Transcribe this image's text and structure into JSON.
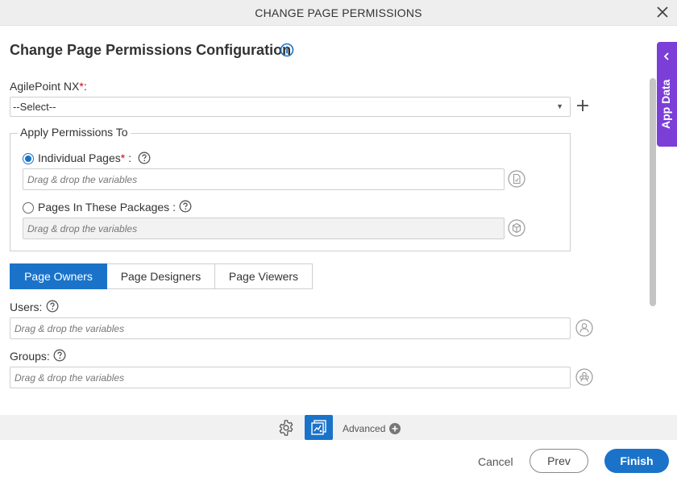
{
  "window": {
    "title": "CHANGE PAGE PERMISSIONS"
  },
  "heading": "Change Page Permissions Configuration",
  "agilepoint": {
    "label": "AgilePoint NX",
    "required_mark": "*",
    "suffix": ":",
    "selected": "--Select--"
  },
  "apply_permissions": {
    "legend": "Apply Permissions To",
    "individual": {
      "label": "Individual Pages",
      "required_mark": "*",
      "suffix": " :",
      "placeholder": "Drag & drop the variables",
      "selected": true
    },
    "packages": {
      "label": "Pages In These Packages :",
      "placeholder": "Drag & drop the variables",
      "selected": false
    }
  },
  "tabs": [
    {
      "label": "Page Owners",
      "active": true
    },
    {
      "label": "Page Designers",
      "active": false
    },
    {
      "label": "Page Viewers",
      "active": false
    }
  ],
  "users": {
    "label": "Users:",
    "placeholder": "Drag & drop the variables"
  },
  "groups": {
    "label": "Groups:",
    "placeholder": "Drag & drop the variables"
  },
  "app_data": {
    "label": "App Data"
  },
  "toolbar": {
    "advanced_label": "Advanced"
  },
  "footer": {
    "cancel": "Cancel",
    "prev": "Prev",
    "finish": "Finish"
  },
  "colors": {
    "primary": "#1a73c9",
    "app_data_tab": "#7b3fd8",
    "required": "#d0021b"
  }
}
